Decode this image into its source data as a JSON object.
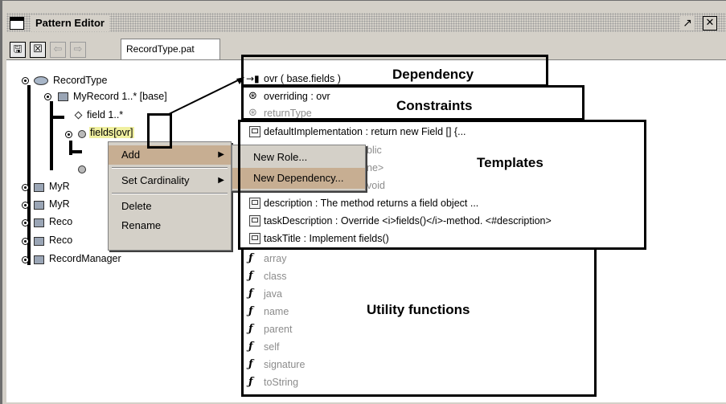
{
  "window": {
    "title": "Pattern Editor",
    "controls": [
      "undock-icon",
      "close-icon"
    ]
  },
  "toolbar": {
    "buttons": [
      "save-icon",
      "close-icon",
      "back-arrow-icon",
      "forward-arrow-icon"
    ],
    "file_tab": "RecordType.pat"
  },
  "tree": {
    "root": "RecordType",
    "items": [
      "MyRecord 1..* [base]",
      "field 1..*",
      "fields",
      "[ovr]",
      "MyR",
      "MyR",
      "Reco",
      "Reco",
      "RecordManager"
    ]
  },
  "context_menu": {
    "items": [
      "Add",
      "Set Cardinality",
      "Delete",
      "Rename"
    ],
    "submenu": [
      "New Role...",
      "New Dependency..."
    ]
  },
  "details": {
    "dependency": "ovr ( base.fields )",
    "constraints": [
      "overriding : ovr",
      "returnType"
    ],
    "templates": [
      "defaultImplementation : return new Field [] {...",
      "blic",
      "ne>",
      "void",
      "description : The method returns a field object ...",
      "taskDescription : Override <i>fields()</i>-method. <#description>",
      "taskTitle : Implement fields()"
    ],
    "functions": [
      "array",
      "class",
      "java",
      "name",
      "parent",
      "self",
      "signature",
      "toString"
    ]
  },
  "annotations": {
    "dependency": "Dependency",
    "constraints": "Constraints",
    "templates": "Templates",
    "utility": "Utility functions"
  }
}
